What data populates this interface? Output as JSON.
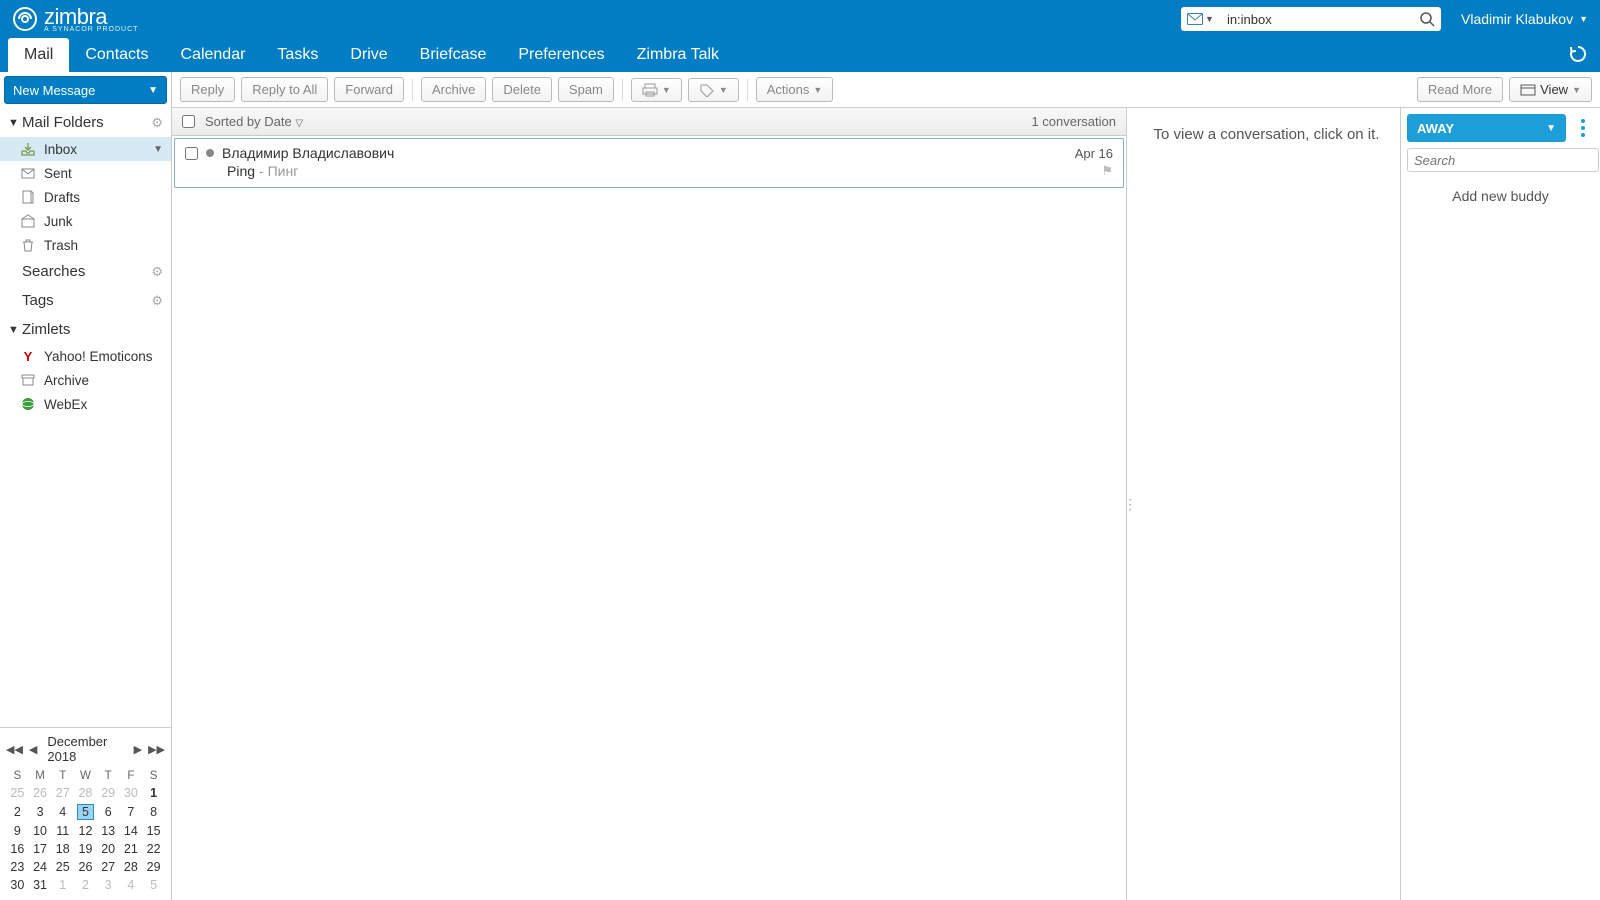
{
  "header": {
    "brand": "zimbra",
    "brand_sub": "A SYNACOR PRODUCT",
    "search_value": "in:inbox",
    "user_name": "Vladimir Klabukov"
  },
  "nav": {
    "tabs": [
      "Mail",
      "Contacts",
      "Calendar",
      "Tasks",
      "Drive",
      "Briefcase",
      "Preferences",
      "Zimbra Talk"
    ],
    "active": "Mail"
  },
  "sidebar": {
    "new_message": "New Message",
    "sections": {
      "mail_folders": "Mail Folders",
      "searches": "Searches",
      "tags": "Tags",
      "zimlets": "Zimlets"
    },
    "folders": [
      {
        "name": "Inbox",
        "selected": true,
        "caret": true
      },
      {
        "name": "Sent"
      },
      {
        "name": "Drafts"
      },
      {
        "name": "Junk"
      },
      {
        "name": "Trash"
      }
    ],
    "zimlets": [
      {
        "name": "Yahoo! Emoticons"
      },
      {
        "name": "Archive"
      },
      {
        "name": "WebEx"
      }
    ]
  },
  "toolbar": {
    "reply": "Reply",
    "reply_all": "Reply to All",
    "forward": "Forward",
    "archive": "Archive",
    "delete": "Delete",
    "spam": "Spam",
    "actions": "Actions",
    "read_more": "Read More",
    "view": "View"
  },
  "list": {
    "sort_label": "Sorted by Date",
    "count_label": "1 conversation",
    "messages": [
      {
        "from": "Владимир Владиславович",
        "subject": "Ping",
        "preview": "Пинг",
        "date": "Apr 16"
      }
    ]
  },
  "reading": {
    "placeholder": "To view a conversation, click on it."
  },
  "chat": {
    "status": "AWAY",
    "search_placeholder": "Search",
    "add_buddy": "Add new buddy"
  },
  "calendar": {
    "title": "December 2018",
    "dow": [
      "S",
      "M",
      "T",
      "W",
      "T",
      "F",
      "S"
    ],
    "weeks": [
      [
        {
          "d": 25,
          "o": true
        },
        {
          "d": 26,
          "o": true
        },
        {
          "d": 27,
          "o": true
        },
        {
          "d": 28,
          "o": true
        },
        {
          "d": 29,
          "o": true
        },
        {
          "d": 30,
          "o": true
        },
        {
          "d": 1,
          "b": true
        }
      ],
      [
        {
          "d": 2
        },
        {
          "d": 3
        },
        {
          "d": 4
        },
        {
          "d": 5,
          "today": true
        },
        {
          "d": 6
        },
        {
          "d": 7
        },
        {
          "d": 8
        }
      ],
      [
        {
          "d": 9
        },
        {
          "d": 10
        },
        {
          "d": 11
        },
        {
          "d": 12
        },
        {
          "d": 13
        },
        {
          "d": 14
        },
        {
          "d": 15
        }
      ],
      [
        {
          "d": 16
        },
        {
          "d": 17
        },
        {
          "d": 18
        },
        {
          "d": 19
        },
        {
          "d": 20
        },
        {
          "d": 21
        },
        {
          "d": 22
        }
      ],
      [
        {
          "d": 23
        },
        {
          "d": 24
        },
        {
          "d": 25
        },
        {
          "d": 26
        },
        {
          "d": 27
        },
        {
          "d": 28
        },
        {
          "d": 29
        }
      ],
      [
        {
          "d": 30
        },
        {
          "d": 31
        },
        {
          "d": 1,
          "o": true
        },
        {
          "d": 2,
          "o": true
        },
        {
          "d": 3,
          "o": true
        },
        {
          "d": 4,
          "o": true
        },
        {
          "d": 5,
          "o": true
        }
      ]
    ]
  }
}
